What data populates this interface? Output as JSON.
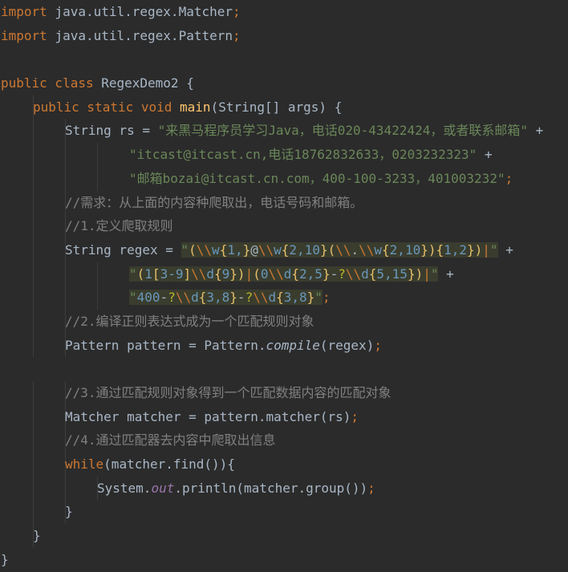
{
  "code": {
    "lines": [
      {
        "indent": 0,
        "tokens": [
          [
            "kw",
            "import "
          ],
          [
            "plain",
            "java.util.regex.Matcher"
          ],
          [
            "kw",
            ";"
          ]
        ]
      },
      {
        "indent": 0,
        "tokens": [
          [
            "kw",
            "import "
          ],
          [
            "plain",
            "java.util.regex.Pattern"
          ],
          [
            "kw",
            ";"
          ]
        ]
      },
      {
        "indent": 0,
        "tokens": []
      },
      {
        "indent": 0,
        "tokens": [
          [
            "kw",
            "public class "
          ],
          [
            "plain",
            "RegexDemo2 {"
          ]
        ]
      },
      {
        "indent": 1,
        "tokens": [
          [
            "kw",
            "public static void "
          ],
          [
            "fn",
            "main"
          ],
          [
            "plain",
            "(String[] args) {"
          ]
        ]
      },
      {
        "indent": 2,
        "tokens": [
          [
            "plain",
            "String rs = "
          ],
          [
            "str",
            "\"来黑马程序员学习Java，电话020-43422424，或者联系邮箱\""
          ],
          [
            "plain",
            " +"
          ]
        ]
      },
      {
        "indent": 4,
        "tokens": [
          [
            "str",
            "\"itcast@itcast.cn,电话18762832633，0203232323\""
          ],
          [
            "plain",
            " +"
          ]
        ]
      },
      {
        "indent": 4,
        "tokens": [
          [
            "str",
            "\"邮箱bozai@itcast.cn.com，400-100-3233，401003232\""
          ],
          [
            "kw",
            ";"
          ]
        ]
      },
      {
        "indent": 2,
        "tokens": [
          [
            "cmt",
            "//需求：从上面的内容种爬取出，电话号码和邮箱。"
          ]
        ]
      },
      {
        "indent": 2,
        "tokens": [
          [
            "cmt",
            "//1.定义爬取规则"
          ]
        ]
      },
      {
        "indent": 2,
        "tokens": [
          [
            "plain",
            "String regex = "
          ],
          [
            "str",
            "\""
          ],
          [
            "rx-br",
            "("
          ],
          [
            "rx-esc",
            "\\\\"
          ],
          [
            "rx-cls",
            "w"
          ],
          [
            "rx-br",
            "{"
          ],
          [
            "num",
            "1,"
          ],
          [
            "rx-br",
            "}"
          ],
          [
            "rx-lit",
            "@"
          ],
          [
            "rx-esc",
            "\\\\"
          ],
          [
            "rx-cls",
            "w"
          ],
          [
            "rx-br",
            "{"
          ],
          [
            "num",
            "2,10"
          ],
          [
            "rx-br",
            "}("
          ],
          [
            "rx-esc",
            "\\\\"
          ],
          [
            "rx-lit",
            "."
          ],
          [
            "rx-esc",
            "\\\\"
          ],
          [
            "rx-cls",
            "w"
          ],
          [
            "rx-br",
            "{"
          ],
          [
            "num",
            "2,10"
          ],
          [
            "rx-br",
            "}){"
          ],
          [
            "num",
            "1,2"
          ],
          [
            "rx-br",
            "})"
          ],
          [
            "rx-pipe",
            "|"
          ],
          [
            "str",
            "\""
          ],
          [
            "plain",
            " +"
          ]
        ]
      },
      {
        "indent": 4,
        "tokens": [
          [
            "str",
            "\""
          ],
          [
            "rx-br",
            "("
          ],
          [
            "num",
            "1"
          ],
          [
            "rx-br",
            "["
          ],
          [
            "num",
            "3-9"
          ],
          [
            "rx-br",
            "]"
          ],
          [
            "rx-esc",
            "\\\\"
          ],
          [
            "rx-cls",
            "d"
          ],
          [
            "rx-br",
            "{"
          ],
          [
            "num",
            "9"
          ],
          [
            "rx-br",
            "})"
          ],
          [
            "rx-pipe",
            "|"
          ],
          [
            "rx-br",
            "("
          ],
          [
            "num",
            "0"
          ],
          [
            "rx-esc",
            "\\\\"
          ],
          [
            "rx-cls",
            "d"
          ],
          [
            "rx-br",
            "{"
          ],
          [
            "num",
            "2,5"
          ],
          [
            "rx-br",
            "}"
          ],
          [
            "rx-lit",
            "-"
          ],
          [
            "rx-op",
            "?"
          ],
          [
            "rx-esc",
            "\\\\"
          ],
          [
            "rx-cls",
            "d"
          ],
          [
            "rx-br",
            "{"
          ],
          [
            "num",
            "5,15"
          ],
          [
            "rx-br",
            "})"
          ],
          [
            "rx-pipe",
            "|"
          ],
          [
            "str",
            "\""
          ],
          [
            "plain",
            " +"
          ]
        ]
      },
      {
        "indent": 4,
        "tokens": [
          [
            "str",
            "\""
          ],
          [
            "num",
            "400"
          ],
          [
            "rx-lit",
            "-"
          ],
          [
            "rx-op",
            "?"
          ],
          [
            "rx-esc",
            "\\\\"
          ],
          [
            "rx-cls",
            "d"
          ],
          [
            "rx-br",
            "{"
          ],
          [
            "num",
            "3,8"
          ],
          [
            "rx-br",
            "}"
          ],
          [
            "rx-lit",
            "-"
          ],
          [
            "rx-op",
            "?"
          ],
          [
            "rx-esc",
            "\\\\"
          ],
          [
            "rx-cls",
            "d"
          ],
          [
            "rx-br",
            "{"
          ],
          [
            "num",
            "3,8"
          ],
          [
            "rx-br",
            "}"
          ],
          [
            "str",
            "\""
          ],
          [
            "kw",
            ";"
          ]
        ]
      },
      {
        "indent": 2,
        "tokens": [
          [
            "cmt",
            "//2.编译正则表达式成为一个匹配规则对象"
          ]
        ]
      },
      {
        "indent": 2,
        "tokens": [
          [
            "plain",
            "Pattern pattern = Pattern."
          ],
          [
            "meth-i",
            "compile"
          ],
          [
            "plain",
            "(regex)"
          ],
          [
            "kw",
            ";"
          ]
        ]
      },
      {
        "indent": 0,
        "tokens": []
      },
      {
        "indent": 2,
        "tokens": [
          [
            "cmt",
            "//3.通过匹配规则对象得到一个匹配数据内容的匹配对象"
          ]
        ]
      },
      {
        "indent": 2,
        "tokens": [
          [
            "plain",
            "Matcher matcher = pattern.matcher(rs)"
          ],
          [
            "kw",
            ";"
          ]
        ]
      },
      {
        "indent": 2,
        "tokens": [
          [
            "cmt",
            "//4.通过匹配器去内容中爬取出信息"
          ]
        ]
      },
      {
        "indent": 2,
        "tokens": [
          [
            "kw",
            "while"
          ],
          [
            "plain",
            "(matcher.find()){"
          ]
        ]
      },
      {
        "indent": 3,
        "tokens": [
          [
            "plain",
            "System."
          ],
          [
            "field",
            "out"
          ],
          [
            "plain",
            ".println(matcher.group())"
          ],
          [
            "kw",
            ";"
          ]
        ]
      },
      {
        "indent": 2,
        "tokens": [
          [
            "plain",
            "}"
          ]
        ]
      },
      {
        "indent": 1,
        "tokens": [
          [
            "plain",
            "}"
          ]
        ]
      },
      {
        "indent": 0,
        "tokens": [
          [
            "plain",
            "}"
          ]
        ]
      }
    ]
  },
  "theme": {
    "background": "#2b2b2b",
    "keyword": "#cc7832",
    "string": "#6a8759",
    "comment": "#808080",
    "method": "#ffc66d",
    "field": "#9876aa",
    "number": "#6897bb",
    "text": "#a9b7c6"
  }
}
